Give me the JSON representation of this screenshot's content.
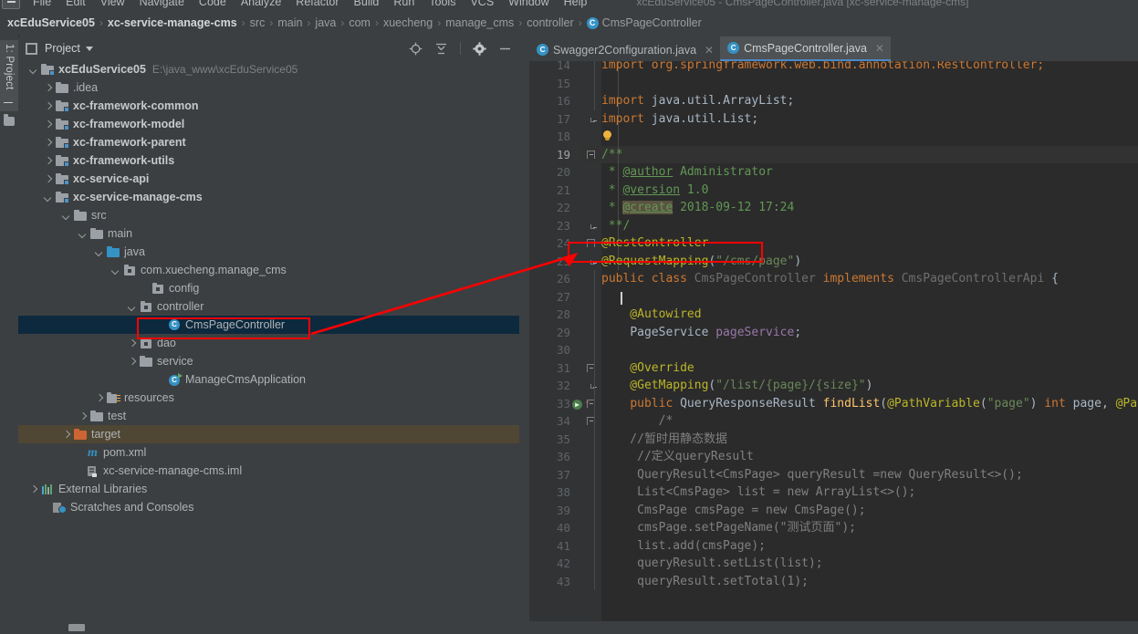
{
  "window": {
    "title": "xcEduService05 - CmsPageController.java [xc-service-manage-cms]"
  },
  "menubar": {
    "items": [
      "File",
      "Edit",
      "View",
      "Navigate",
      "Code",
      "Analyze",
      "Refactor",
      "Build",
      "Run",
      "Tools",
      "VCS",
      "Window",
      "Help"
    ]
  },
  "breadcrumb": {
    "separator": "›",
    "items": [
      {
        "label": "xcEduService05",
        "bold": true
      },
      {
        "label": "xc-service-manage-cms",
        "bold": true
      },
      {
        "label": "src",
        "bold": false
      },
      {
        "label": "main",
        "bold": false
      },
      {
        "label": "java",
        "bold": false
      },
      {
        "label": "com",
        "bold": false
      },
      {
        "label": "xuecheng",
        "bold": false
      },
      {
        "label": "manage_cms",
        "bold": false
      },
      {
        "label": "controller",
        "bold": false
      },
      {
        "label": "CmsPageController",
        "bold": false,
        "icon": "class-icon",
        "icon_letter": "C"
      }
    ]
  },
  "left_tool_strip": {
    "tab_label": "1: Project"
  },
  "project_panel": {
    "title": "Project",
    "caret": "▾",
    "tools": [
      "locate-icon",
      "collapse-all-icon",
      "settings-gear-icon",
      "hide-icon"
    ]
  },
  "tree": {
    "items": [
      {
        "label": "xcEduService05",
        "path": "E:\\java_www\\xcEduService05",
        "indent": 0,
        "arrow": "down",
        "icon": "module-folder-icon",
        "bold": true
      },
      {
        "label": ".idea",
        "indent": 1,
        "arrow": "right",
        "icon": "folder-icon",
        "bold": false
      },
      {
        "label": "xc-framework-common",
        "indent": 1,
        "arrow": "right",
        "icon": "module-folder-icon",
        "bold": true
      },
      {
        "label": "xc-framework-model",
        "indent": 1,
        "arrow": "right",
        "icon": "module-folder-icon",
        "bold": true
      },
      {
        "label": "xc-framework-parent",
        "indent": 1,
        "arrow": "right",
        "icon": "module-folder-icon",
        "bold": true
      },
      {
        "label": "xc-framework-utils",
        "indent": 1,
        "arrow": "right",
        "icon": "module-folder-icon",
        "bold": true
      },
      {
        "label": "xc-service-api",
        "indent": 1,
        "arrow": "right",
        "icon": "module-folder-icon",
        "bold": true
      },
      {
        "label": "xc-service-manage-cms",
        "indent": 1,
        "arrow": "down",
        "icon": "module-folder-icon",
        "bold": true
      },
      {
        "label": "src",
        "indent": 2,
        "arrow": "down",
        "icon": "folder-icon",
        "bold": false
      },
      {
        "label": "main",
        "indent": 3,
        "arrow": "down",
        "icon": "folder-icon",
        "bold": false
      },
      {
        "label": "java",
        "indent": 4,
        "arrow": "down",
        "icon": "source-folder-icon",
        "bold": false
      },
      {
        "label": "com.xuecheng.manage_cms",
        "indent": 5,
        "arrow": "down",
        "icon": "package-icon",
        "bold": false
      },
      {
        "label": "config",
        "indent": 6,
        "arrow": "none",
        "icon": "package-icon",
        "bold": false
      },
      {
        "label": "controller",
        "indent": 6,
        "arrow": "down",
        "icon": "package-icon",
        "bold": false
      },
      {
        "label": "CmsPageController",
        "indent": 7,
        "arrow": "none",
        "icon": "class-icon",
        "bold": false,
        "selected": true,
        "highlighted": true
      },
      {
        "label": "dao",
        "indent": 6,
        "arrow": "right",
        "icon": "package-icon",
        "bold": false
      },
      {
        "label": "service",
        "indent": 6,
        "arrow": "right",
        "icon": "package-icon",
        "bold": false
      },
      {
        "label": "ManageCmsApplication",
        "indent": 6,
        "arrow": "none",
        "icon": "runnable-class-icon",
        "bold": false
      },
      {
        "label": "resources",
        "indent": 4,
        "arrow": "right",
        "icon": "resources-folder-icon",
        "bold": false
      },
      {
        "label": "test",
        "indent": 3,
        "arrow": "right",
        "icon": "folder-icon",
        "bold": false
      },
      {
        "label": "target",
        "indent": 2,
        "arrow": "right",
        "icon": "target-folder-icon",
        "bold": false,
        "excluded": true
      },
      {
        "label": "pom.xml",
        "indent": 2,
        "arrow": "none",
        "icon": "maven-icon",
        "bold": false
      },
      {
        "label": "xc-service-manage-cms.iml",
        "indent": 2,
        "arrow": "none",
        "icon": "iml-file-icon",
        "bold": false
      },
      {
        "label": "External Libraries",
        "indent": 0,
        "arrow": "right",
        "icon": "libraries-icon",
        "bold": false
      },
      {
        "label": "Scratches and Consoles",
        "indent": 0,
        "arrow": "none",
        "icon": "scratches-icon",
        "bold": false
      }
    ]
  },
  "editor_tabs": [
    {
      "label": "Swagger2Configuration.java",
      "active": false,
      "icon": "class-icon",
      "icon_letter": "C",
      "close": "✕"
    },
    {
      "label": "CmsPageController.java",
      "active": true,
      "icon": "class-icon",
      "icon_letter": "C",
      "close": "✕"
    }
  ],
  "code": {
    "first_line": 14,
    "current_line": 19,
    "lines": [
      {
        "n": 14,
        "clipped_top": true,
        "tokens": [
          {
            "t": "import org.springframework.web.bind.annotation.RestController;",
            "c": "kw"
          }
        ]
      },
      {
        "n": 15,
        "tokens": []
      },
      {
        "n": 16,
        "tokens": [
          {
            "t": "import ",
            "c": "kw"
          },
          {
            "t": "java.util.ArrayList;",
            "c": "plain"
          }
        ]
      },
      {
        "n": 17,
        "fold": "tee",
        "tokens": [
          {
            "t": "import ",
            "c": "kw"
          },
          {
            "t": "java.util.List;",
            "c": "plain"
          }
        ]
      },
      {
        "n": 18,
        "bulb": true,
        "tokens": []
      },
      {
        "n": 19,
        "current": true,
        "fold": "tee",
        "tokens": [
          {
            "t": "/**",
            "c": "doc"
          }
        ]
      },
      {
        "n": 20,
        "tokens": [
          {
            "t": " * ",
            "c": "doc"
          },
          {
            "t": "@author",
            "c": "doctag"
          },
          {
            "t": " Administrator",
            "c": "doc"
          }
        ]
      },
      {
        "n": 21,
        "tokens": [
          {
            "t": " * ",
            "c": "doc"
          },
          {
            "t": "@version",
            "c": "doctag"
          },
          {
            "t": " 1.0",
            "c": "doc"
          }
        ]
      },
      {
        "n": 22,
        "tokens": [
          {
            "t": " * ",
            "c": "doc"
          },
          {
            "t": "@create",
            "c": "doctag-hl"
          },
          {
            "t": " 2018-09-12 17:24",
            "c": "doc"
          }
        ]
      },
      {
        "n": 23,
        "fold": "end",
        "tokens": [
          {
            "t": " **/",
            "c": "doc"
          }
        ]
      },
      {
        "n": 24,
        "fold": "tee",
        "boxed": true,
        "tokens": [
          {
            "t": "@RestController",
            "c": "ann"
          }
        ]
      },
      {
        "n": 25,
        "fold": "end",
        "tokens": [
          {
            "t": "@RequestMapping",
            "c": "ann"
          },
          {
            "t": "(",
            "c": "plain"
          },
          {
            "t": "\"/cms/page\"",
            "c": "str"
          },
          {
            "t": ")",
            "c": "plain"
          }
        ]
      },
      {
        "n": 26,
        "tokens": [
          {
            "t": "public class ",
            "c": "kw"
          },
          {
            "t": "CmsPageController ",
            "c": "faded"
          },
          {
            "t": "implements ",
            "c": "kw"
          },
          {
            "t": "CmsPageControllerApi ",
            "c": "faded"
          },
          {
            "t": "{",
            "c": "plain"
          }
        ]
      },
      {
        "n": 27,
        "caret": true,
        "tokens": []
      },
      {
        "n": 28,
        "tokens": [
          {
            "t": "    @Autowired",
            "c": "ann"
          }
        ]
      },
      {
        "n": 29,
        "tokens": [
          {
            "t": "    ",
            "c": "plain"
          },
          {
            "t": "PageService ",
            "c": "typ"
          },
          {
            "t": "pageService",
            "c": "fld"
          },
          {
            "t": ";",
            "c": "plain"
          }
        ]
      },
      {
        "n": 30,
        "tokens": []
      },
      {
        "n": 31,
        "fold": "tee",
        "tokens": [
          {
            "t": "    @Override",
            "c": "ann"
          }
        ]
      },
      {
        "n": 32,
        "fold": "end",
        "tokens": [
          {
            "t": "    @GetMapping",
            "c": "ann"
          },
          {
            "t": "(",
            "c": "plain"
          },
          {
            "t": "\"/list/{page}/{size}\"",
            "c": "str"
          },
          {
            "t": ")",
            "c": "plain"
          }
        ]
      },
      {
        "n": 33,
        "runmark": true,
        "overridemark": true,
        "fold": "tee",
        "tokens": [
          {
            "t": "    ",
            "c": "plain"
          },
          {
            "t": "public ",
            "c": "kw"
          },
          {
            "t": "QueryResponseResult ",
            "c": "typ"
          },
          {
            "t": "findList",
            "c": "mth"
          },
          {
            "t": "(",
            "c": "plain"
          },
          {
            "t": "@PathVariable",
            "c": "ann"
          },
          {
            "t": "(",
            "c": "plain"
          },
          {
            "t": "\"page\"",
            "c": "str"
          },
          {
            "t": ") ",
            "c": "plain"
          },
          {
            "t": "int ",
            "c": "kw"
          },
          {
            "t": "page",
            "c": "typ"
          },
          {
            "t": ", ",
            "c": "plain"
          },
          {
            "t": "@Pat",
            "c": "ann"
          }
        ]
      },
      {
        "n": 34,
        "fold": "tee",
        "tokens": [
          {
            "t": "        /*",
            "c": "cmt"
          }
        ]
      },
      {
        "n": 35,
        "tokens": [
          {
            "t": "    //暂时用静态数据",
            "c": "cmt"
          }
        ]
      },
      {
        "n": 36,
        "tokens": [
          {
            "t": "     //定义queryResult",
            "c": "cmt"
          }
        ]
      },
      {
        "n": 37,
        "tokens": [
          {
            "t": "     QueryResult<CmsPage> queryResult =new QueryResult<>();",
            "c": "cmt"
          }
        ]
      },
      {
        "n": 38,
        "tokens": [
          {
            "t": "     List<CmsPage> list = new ArrayList<>();",
            "c": "cmt"
          }
        ]
      },
      {
        "n": 39,
        "tokens": [
          {
            "t": "     CmsPage cmsPage = new CmsPage();",
            "c": "cmt"
          }
        ]
      },
      {
        "n": 40,
        "tokens": [
          {
            "t": "     cmsPage.setPageName(\"测试页面\");",
            "c": "cmt"
          }
        ]
      },
      {
        "n": 41,
        "tokens": [
          {
            "t": "     list.add(cmsPage);",
            "c": "cmt"
          }
        ]
      },
      {
        "n": 42,
        "tokens": [
          {
            "t": "     queryResult.setList(list);",
            "c": "cmt"
          }
        ]
      },
      {
        "n": 43,
        "tokens": [
          {
            "t": "     queryResult.setTotal(1);",
            "c": "cmt"
          }
        ]
      }
    ]
  },
  "annotations": {
    "color": "#ff0000",
    "tree_box": {
      "label": "CmsPageController tree node highlight"
    },
    "code_box": {
      "label": "@RestController annotation highlight"
    },
    "arrow": {
      "label": "pointer from tree node to @RestController"
    }
  },
  "colors": {
    "accent_blue": "#3592c4",
    "editor_bg": "#2b2b2b",
    "panel_bg": "#3c3f41",
    "selection_bg": "#0d293e",
    "excluded_bg": "#4f4634",
    "annotation_red": "#ff0000",
    "annotation_string": "#6a8759",
    "annotation_yellow": "#bbb529",
    "keyword_orange": "#cc7832"
  }
}
